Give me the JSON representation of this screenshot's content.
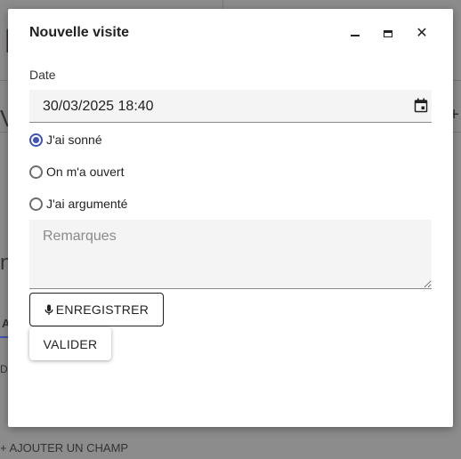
{
  "dialog": {
    "title": "Nouvelle visite",
    "date_label": "Date",
    "date_value": "30/03/2025 18:40",
    "radios": [
      {
        "label": "J'ai sonné",
        "checked": true
      },
      {
        "label": "On m'a ouvert",
        "checked": false
      },
      {
        "label": "J'ai argumenté",
        "checked": false
      }
    ],
    "remarks_placeholder": "Remarques",
    "record_label": "ENREGISTRER",
    "validate_label": "VALIDER"
  },
  "colors": {
    "accent": "#3f51b5",
    "field_bg": "#f4f4f4",
    "overlay": "#8c8c8c"
  },
  "icons": [
    "minimize-icon",
    "maximize-icon",
    "close-icon",
    "calendar-icon",
    "microphone-icon"
  ]
}
